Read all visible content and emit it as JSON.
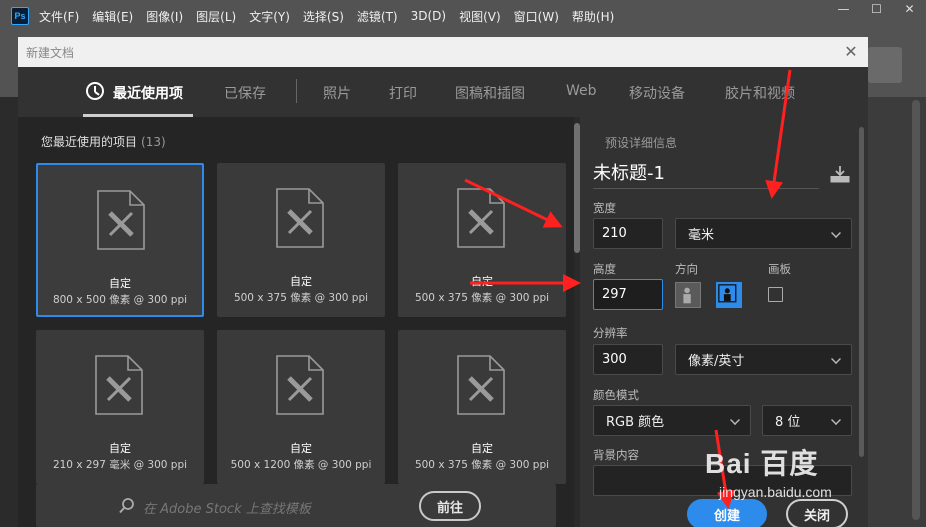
{
  "app": {
    "logo": "Ps",
    "menu": [
      "文件(F)",
      "编辑(E)",
      "图像(I)",
      "图层(L)",
      "文字(Y)",
      "选择(S)",
      "滤镜(T)",
      "3D(D)",
      "视图(V)",
      "窗口(W)",
      "帮助(H)"
    ],
    "window_controls": [
      "—",
      "☐",
      "✕"
    ]
  },
  "dialog": {
    "title": "新建文档",
    "close_glyph": "✕",
    "tabs": [
      {
        "label": "最近使用项",
        "active": true
      },
      {
        "label": "已保存"
      },
      {
        "label": "照片"
      },
      {
        "label": "打印"
      },
      {
        "label": "图稿和插图"
      },
      {
        "label": "Web"
      },
      {
        "label": "移动设备"
      },
      {
        "label": "胶片和视频"
      }
    ],
    "recent": {
      "heading": "您最近使用的项目",
      "count": "(13)",
      "items": [
        {
          "name": "自定",
          "size": "800 x 500 像素 @ 300 ppi",
          "selected": true
        },
        {
          "name": "自定",
          "size": "500 x 375 像素 @ 300 ppi"
        },
        {
          "name": "自定",
          "size": "500 x 375 像素 @ 300 ppi"
        },
        {
          "name": "自定",
          "size": "210 x 297 毫米 @ 300 ppi"
        },
        {
          "name": "自定",
          "size": "500 x 1200 像素 @ 300 ppi"
        },
        {
          "name": "自定",
          "size": "500 x 375 像素 @ 300 ppi"
        }
      ]
    },
    "stock": {
      "placeholder": "在 Adobe Stock 上查找模板",
      "go_label": "前往"
    },
    "preset": {
      "heading": "预设详细信息",
      "doc_name": "未标题-1",
      "width_label": "宽度",
      "width_value": "210",
      "width_unit": "毫米",
      "height_label": "高度",
      "height_value": "297",
      "orientation_label": "方向",
      "artboard_label": "画板",
      "resolution_label": "分辨率",
      "resolution_value": "300",
      "resolution_unit": "像素/英寸",
      "color_mode_label": "颜色模式",
      "color_mode_value": "RGB 颜色",
      "bit_depth_value": "8 位",
      "background_label": "背景内容"
    },
    "buttons": {
      "create": "创建",
      "close": "关闭"
    }
  },
  "watermark": {
    "text": "Bai 百度",
    "sub": "jingyan.baidu.com"
  },
  "colors": {
    "accent": "#2d8ceb",
    "annotation": "#ff2020"
  }
}
